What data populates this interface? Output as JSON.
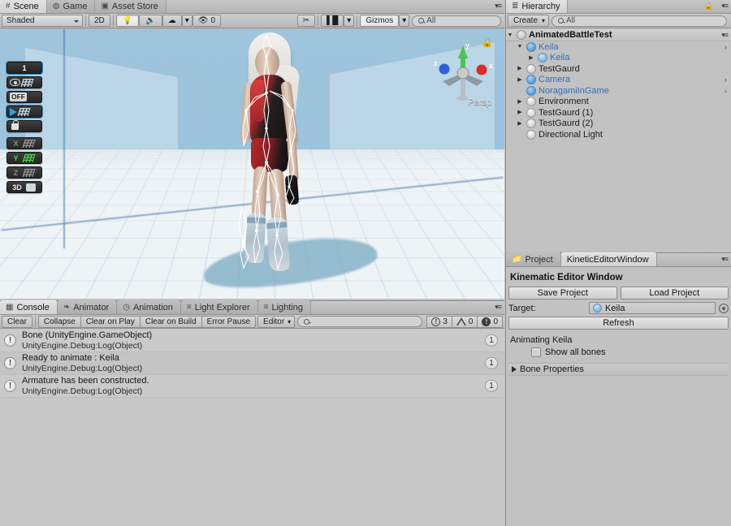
{
  "scene": {
    "tabs": [
      {
        "label": "Scene",
        "icon": "grid-icon",
        "active": true
      },
      {
        "label": "Game",
        "icon": "gamepad-icon",
        "active": false
      },
      {
        "label": "Asset Store",
        "icon": "store-icon",
        "active": false
      }
    ],
    "toolbar": {
      "draw_mode": "Shaded",
      "two_d": "2D",
      "lighting_icon": "lightbulb-icon",
      "audio_icon": "speaker-icon",
      "fx_icon": "effects-icon",
      "tools_icon": "tools-icon",
      "camera_icon": "camera-icon",
      "gizmos": "Gizmos",
      "search_placeholder": "All",
      "hidden_count": "0"
    },
    "gizmo": {
      "x_label": "x",
      "y_label": "y",
      "z_label": "z",
      "projection": "Persp",
      "lock_icon": "lock-icon"
    },
    "snap_toolbar": {
      "grid_size": "1",
      "visibility_icon": "eye-icon",
      "opacity_label": "OFF",
      "move_icon": "arrow-right-icon",
      "lock_icon": "lock-icon",
      "axes": [
        {
          "label": "X",
          "active": false
        },
        {
          "label": "Y",
          "active": true
        },
        {
          "label": "Z",
          "active": false
        }
      ],
      "mode_3d": "3D"
    }
  },
  "hierarchy": {
    "tab_label": "Hierarchy",
    "lock_icon": "lock-icon",
    "menu_icon": "panel-menu-icon",
    "create_label": "Create",
    "search_placeholder": "All",
    "scene_name": "AnimatedBattleTest",
    "items": [
      {
        "label": "Keila",
        "indent": 1,
        "expanded": true,
        "has_children": true,
        "type": "prefab",
        "selected": true,
        "chevron": true
      },
      {
        "label": "Keila",
        "indent": 2,
        "expanded": false,
        "has_children": true,
        "type": "model",
        "selected": true,
        "chevron": false
      },
      {
        "label": "TestGaurd",
        "indent": 1,
        "expanded": false,
        "has_children": true,
        "type": "plain",
        "selected": false,
        "chevron": false
      },
      {
        "label": "Camera",
        "indent": 1,
        "expanded": false,
        "has_children": true,
        "type": "prefab",
        "selected": true,
        "chevron": true
      },
      {
        "label": "NoragamiInGame",
        "indent": 1,
        "expanded": false,
        "has_children": false,
        "type": "prefab",
        "selected": true,
        "chevron": true
      },
      {
        "label": "Environment",
        "indent": 1,
        "expanded": false,
        "has_children": true,
        "type": "plain",
        "selected": false,
        "chevron": false
      },
      {
        "label": "TestGaurd (1)",
        "indent": 1,
        "expanded": false,
        "has_children": true,
        "type": "plain",
        "selected": false,
        "chevron": false
      },
      {
        "label": "TestGaurd (2)",
        "indent": 1,
        "expanded": false,
        "has_children": true,
        "type": "plain",
        "selected": false,
        "chevron": false
      },
      {
        "label": "Directional Light",
        "indent": 1,
        "expanded": false,
        "has_children": false,
        "type": "plain",
        "selected": false,
        "chevron": false
      }
    ]
  },
  "kinetic_editor": {
    "tabs": [
      {
        "label": "Project",
        "icon": "folder-icon",
        "active": false
      },
      {
        "label": "KineticEditorWindow",
        "icon": "",
        "active": true
      }
    ],
    "menu_icon": "panel-menu-icon",
    "title": "Kinematic Editor Window",
    "save_label": "Save Project",
    "load_label": "Load Project",
    "target_label": "Target:",
    "target_value": "Keila",
    "target_picker_icon": "object-picker-icon",
    "refresh_label": "Refresh",
    "status_text": "Animating Keila",
    "show_all_bones_label": "Show all bones",
    "show_all_bones_checked": false,
    "bone_properties_label": "Bone Properties",
    "bone_properties_expanded": false
  },
  "console": {
    "tabs": [
      {
        "label": "Console",
        "icon": "console-icon",
        "active": true
      },
      {
        "label": "Animator",
        "icon": "animator-icon",
        "active": false
      },
      {
        "label": "Animation",
        "icon": "clock-icon",
        "active": false
      },
      {
        "label": "Light Explorer",
        "icon": "sliders-icon",
        "active": false
      },
      {
        "label": "Lighting",
        "icon": "sliders-icon",
        "active": false
      }
    ],
    "menu_icon": "panel-menu-icon",
    "toolbar": {
      "clear": "Clear",
      "collapse": "Collapse",
      "clear_on_play": "Clear on Play",
      "clear_on_build": "Clear on Build",
      "error_pause": "Error Pause",
      "editor": "Editor",
      "search_placeholder": ""
    },
    "counters": {
      "info": "3",
      "warning": "0",
      "error": "0"
    },
    "logs": [
      {
        "message": "Bone (UnityEngine.GameObject)",
        "stack": "UnityEngine.Debug:Log(Object)",
        "count": "1",
        "level": "info"
      },
      {
        "message": "Ready to animate : Keila",
        "stack": "UnityEngine.Debug:Log(Object)",
        "count": "1",
        "level": "info"
      },
      {
        "message": "Armature has been constructed.",
        "stack": "UnityEngine.Debug:Log(Object)",
        "count": "1",
        "level": "info"
      }
    ]
  },
  "colors": {
    "scene_bg": "#9cc3dc",
    "chrome": "#c2c2c2",
    "selection_blue": "#2f6fb5",
    "axis_x": "#e03030",
    "axis_y": "#3fc23f",
    "axis_z": "#2f6fd0"
  }
}
